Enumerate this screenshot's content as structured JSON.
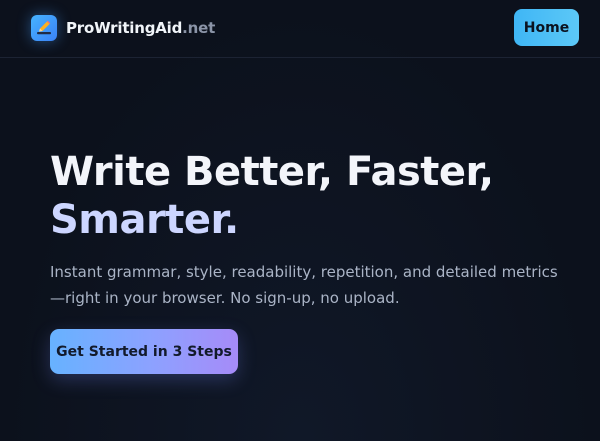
{
  "header": {
    "brand_name": "ProWritingAid",
    "brand_domain": ".net",
    "logo_icon": "pencil-edit-icon",
    "home_label": "Home"
  },
  "hero": {
    "title_line1": "Write Better, Faster,",
    "title_line2": "Smarter.",
    "subtitle": "Instant grammar, style, readability, repetition, and detailed metrics—right in your browser. No sign-up, no upload.",
    "cta_label": "Get Started in 3 Steps"
  },
  "colors": {
    "background": "#0c111c",
    "logo_accent": "#3b82f6",
    "home_button": "#3fb6f5",
    "cta_gradient_start": "#67b2ff",
    "cta_gradient_end": "#a68bf8",
    "title_accent": "#cdd6ff"
  }
}
